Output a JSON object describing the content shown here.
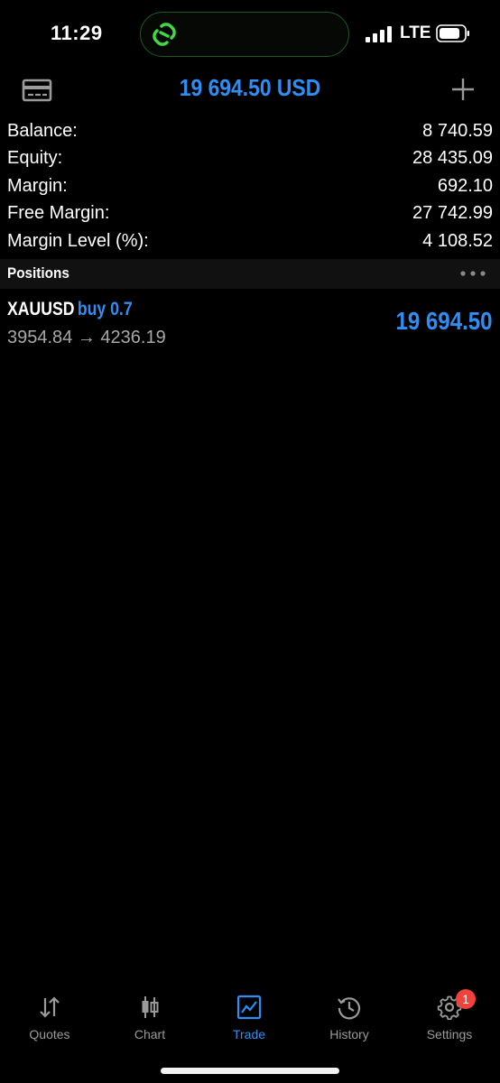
{
  "status_bar": {
    "time": "11:29",
    "carrier": "LTE",
    "island_icon": "link-icon",
    "island_accent": "#3ddc45"
  },
  "header": {
    "title": "19 694.50 USD",
    "left_icon": "account-card-icon",
    "right_icon": "plus-icon",
    "accent": "#2f8ef4"
  },
  "summary": [
    {
      "label": "Balance:",
      "value": "8 740.59"
    },
    {
      "label": "Equity:",
      "value": "28 435.09"
    },
    {
      "label": "Margin:",
      "value": "692.10"
    },
    {
      "label": "Free Margin:",
      "value": "27 742.99"
    },
    {
      "label": "Margin Level (%):",
      "value": "4 108.52"
    }
  ],
  "positions": {
    "title": "Positions",
    "more_icon": "more-dots-icon",
    "items": [
      {
        "symbol": "XAUUSD",
        "side": "buy 0.7",
        "prices": "3954.84 → 4236.19",
        "profit": "19 694.50"
      }
    ]
  },
  "tabs": [
    {
      "label": "Quotes",
      "icon": "quotes-arrows-icon",
      "active": false
    },
    {
      "label": "Chart",
      "icon": "candlestick-icon",
      "active": false
    },
    {
      "label": "Trade",
      "icon": "trade-chart-icon",
      "active": true
    },
    {
      "label": "History",
      "icon": "history-clock-icon",
      "active": false
    },
    {
      "label": "Settings",
      "icon": "gear-icon",
      "active": false,
      "badge": "1"
    }
  ],
  "colors": {
    "background": "#000000",
    "accent": "#2f8ef4",
    "badge": "#f0413b",
    "muted": "#9a9a9a"
  }
}
